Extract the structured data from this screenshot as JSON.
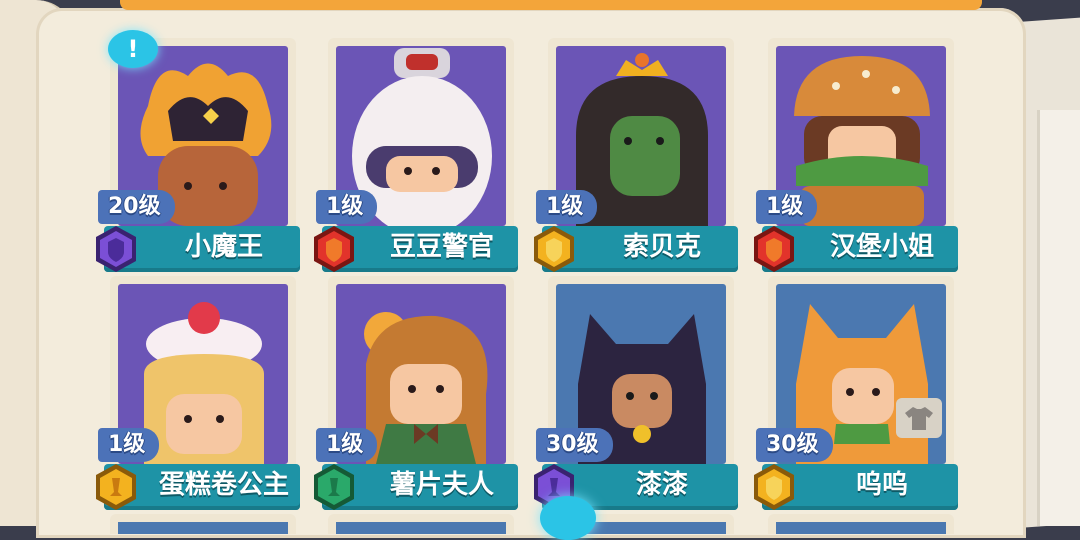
{
  "characters": [
    {
      "level": "20级",
      "name": "小魔王",
      "rank": "purple",
      "bg": "purple"
    },
    {
      "level": "1级",
      "name": "豆豆警官",
      "rank": "red",
      "bg": "purple"
    },
    {
      "level": "1级",
      "name": "索贝克",
      "rank": "gold",
      "bg": "purple"
    },
    {
      "level": "1级",
      "name": "汉堡小姐",
      "rank": "red",
      "bg": "purple"
    },
    {
      "level": "1级",
      "name": "蛋糕卷公主",
      "rank": "gold",
      "bg": "purple"
    },
    {
      "level": "1级",
      "name": "薯片夫人",
      "rank": "green",
      "bg": "purple"
    },
    {
      "level": "30级",
      "name": "漆漆",
      "rank": "purple",
      "bg": "blue"
    },
    {
      "level": "30级",
      "name": "呜呜",
      "rank": "gold",
      "bg": "blue"
    }
  ],
  "colors": {
    "purple": "#7b4fd6",
    "red": "#e2332b",
    "gold": "#f3b21f",
    "green": "#2aa96a",
    "namebar": "#1e93a6",
    "levelbar": "#4c72b8"
  },
  "icons": {
    "notice": "exclamation-icon",
    "shirt": "shirt-icon"
  }
}
